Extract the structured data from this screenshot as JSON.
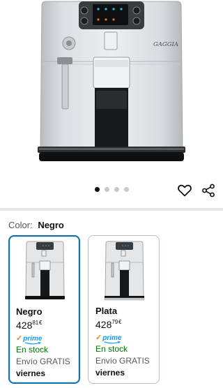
{
  "product": {
    "brand_logo": "GAGGIA",
    "image_icon": "espresso-machine-icon"
  },
  "carousel": {
    "count": 4,
    "active_index": 0
  },
  "actions": {
    "wishlist_icon": "heart-icon",
    "share_icon": "share-icon"
  },
  "color_selector": {
    "label": "Color:",
    "selected_value": "Negro",
    "options": [
      {
        "name": "Negro",
        "price_whole": "428",
        "price_fraction": "81",
        "currency": "€",
        "prime": "prime",
        "prime_check": "✓",
        "stock": "En stock",
        "shipping": "Envío GRATIS",
        "delivery": "viernes",
        "selected": true
      },
      {
        "name": "Plata",
        "price_whole": "428",
        "price_fraction": "79",
        "currency": "€",
        "prime": "prime",
        "prime_check": "✓",
        "stock": "En stock",
        "shipping": "Envío GRATIS",
        "delivery": "viernes",
        "selected": false
      }
    ]
  },
  "colors": {
    "selected_border": "#1a6fa8",
    "in_stock": "#007600",
    "prime_blue": "#1399ff",
    "prime_orange": "#f08804"
  }
}
